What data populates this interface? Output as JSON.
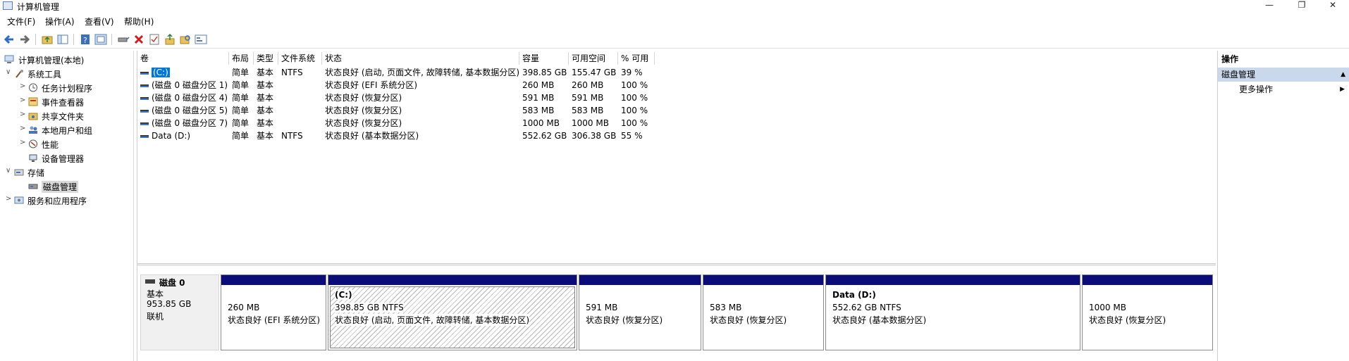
{
  "window": {
    "title": "计算机管理",
    "controls": {
      "minimize": "—",
      "maximize": "❐",
      "close": "✕"
    }
  },
  "menu": [
    "文件(F)",
    "操作(A)",
    "查看(V)",
    "帮助(H)"
  ],
  "toolbar": {
    "icons": [
      "back-arrow-icon",
      "forward-arrow-icon",
      "up-folder-icon",
      "show-hide-tree-icon",
      "help-icon",
      "properties-view-icon",
      "connect-drive-icon",
      "delete-icon",
      "check-icon",
      "export-icon",
      "search-folder-icon",
      "panel-icon"
    ]
  },
  "tree": {
    "root": "计算机管理(本地)",
    "nodes": [
      {
        "label": "系统工具",
        "level": 1,
        "expander": "∨",
        "icon": "tools-icon"
      },
      {
        "label": "任务计划程序",
        "level": 2,
        "expander": ">",
        "icon": "clock-icon"
      },
      {
        "label": "事件查看器",
        "level": 2,
        "expander": ">",
        "icon": "event-viewer-icon"
      },
      {
        "label": "共享文件夹",
        "level": 2,
        "expander": ">",
        "icon": "shared-folder-icon"
      },
      {
        "label": "本地用户和组",
        "level": 2,
        "expander": ">",
        "icon": "users-icon"
      },
      {
        "label": "性能",
        "level": 2,
        "expander": ">",
        "icon": "performance-icon"
      },
      {
        "label": "设备管理器",
        "level": 2,
        "expander": "",
        "icon": "device-manager-icon"
      },
      {
        "label": "存储",
        "level": 1,
        "expander": "∨",
        "icon": "storage-icon"
      },
      {
        "label": "磁盘管理",
        "level": 2,
        "expander": "",
        "icon": "disk-management-icon",
        "selected": true
      },
      {
        "label": "服务和应用程序",
        "level": 1,
        "expander": ">",
        "icon": "services-icon"
      }
    ]
  },
  "volumes": {
    "columns": [
      "卷",
      "布局",
      "类型",
      "文件系统",
      "状态",
      "容量",
      "可用空间",
      "% 可用"
    ],
    "rows": [
      [
        "(C:)",
        "简单",
        "基本",
        "NTFS",
        "状态良好 (启动, 页面文件, 故障转储, 基本数据分区)",
        "398.85 GB",
        "155.47 GB",
        "39 %"
      ],
      [
        "(磁盘 0 磁盘分区 1)",
        "简单",
        "基本",
        "",
        "状态良好 (EFI 系统分区)",
        "260 MB",
        "260 MB",
        "100 %"
      ],
      [
        "(磁盘 0 磁盘分区 4)",
        "简单",
        "基本",
        "",
        "状态良好 (恢复分区)",
        "591 MB",
        "591 MB",
        "100 %"
      ],
      [
        "(磁盘 0 磁盘分区 5)",
        "简单",
        "基本",
        "",
        "状态良好 (恢复分区)",
        "583 MB",
        "583 MB",
        "100 %"
      ],
      [
        "(磁盘 0 磁盘分区 7)",
        "简单",
        "基本",
        "",
        "状态良好 (恢复分区)",
        "1000 MB",
        "1000 MB",
        "100 %"
      ],
      [
        "Data (D:)",
        "简单",
        "基本",
        "NTFS",
        "状态良好 (基本数据分区)",
        "552.62 GB",
        "306.38 GB",
        "55 %"
      ]
    ]
  },
  "disk": {
    "name": "磁盘 0",
    "type": "基本",
    "size": "953.85 GB",
    "status": "联机",
    "partitions": [
      {
        "title": "",
        "size": "260 MB",
        "status": "状态良好 (EFI 系统分区)"
      },
      {
        "title": "(C:)",
        "size": "398.85 GB NTFS",
        "status": "状态良好 (启动, 页面文件, 故障转储, 基本数据分区)"
      },
      {
        "title": "",
        "size": "591 MB",
        "status": "状态良好 (恢复分区)"
      },
      {
        "title": "",
        "size": "583 MB",
        "status": "状态良好 (恢复分区)"
      },
      {
        "title": "Data  (D:)",
        "size": "552.62 GB NTFS",
        "status": "状态良好 (基本数据分区)"
      },
      {
        "title": "",
        "size": "1000 MB",
        "status": "状态良好 (恢复分区)"
      }
    ]
  },
  "actions": {
    "header": "操作",
    "section": "磁盘管理",
    "section_caret": "▲",
    "item": "更多操作",
    "item_arrow": "▶"
  },
  "colors": {
    "partition_bar": "#0b0b7a",
    "selection": "#0078d7",
    "actions_section": "#c9d8ea"
  }
}
